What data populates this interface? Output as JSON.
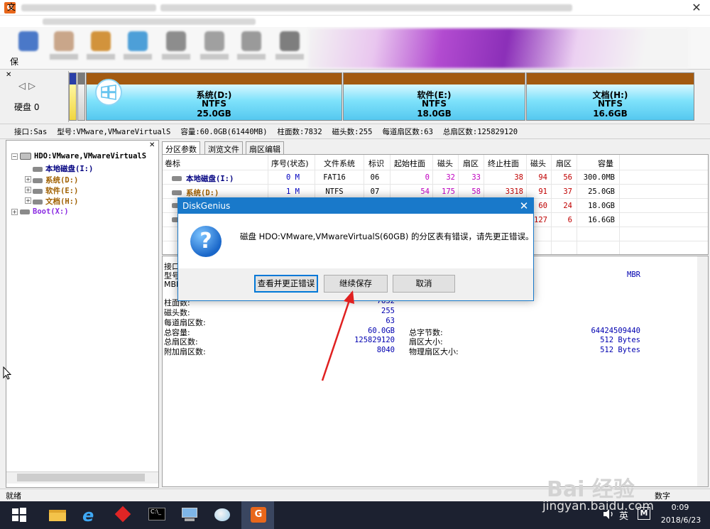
{
  "window": {
    "menu_file": "文",
    "toolbar_save": "保"
  },
  "diskstrip": {
    "disk_label": "硬盘 0",
    "partitions": [
      {
        "name": "系统(D:)",
        "fs": "NTFS",
        "size": "25.0GB"
      },
      {
        "name": "软件(E:)",
        "fs": "NTFS",
        "size": "18.0GB"
      },
      {
        "name": "文档(H:)",
        "fs": "NTFS",
        "size": "16.6GB"
      }
    ]
  },
  "infoline": {
    "interface": "接口:Sas",
    "model": "型号:VMware,VMwareVirtualS",
    "capacity": "容量:60.0GB(61440MB)",
    "cylinders": "柱面数:7832",
    "heads": "磁头数:255",
    "sectors_per_track": "每道扇区数:63",
    "total_sectors": "总扇区数:125829120"
  },
  "tree": {
    "root": "HDO:VMware,VMwareVirtualS",
    "items": [
      {
        "label": "本地磁盘(I:)",
        "color": "#000080"
      },
      {
        "label": "系统(D:)",
        "color": "#a06000"
      },
      {
        "label": "软件(E:)",
        "color": "#a06000"
      },
      {
        "label": "文档(H:)",
        "color": "#a06000"
      },
      {
        "label": "Boot(X:)",
        "color": "#8a2be2"
      }
    ]
  },
  "tabs": [
    "分区参数",
    "浏览文件",
    "扇区编辑"
  ],
  "table": {
    "headers": [
      "卷标",
      "序号(状态)",
      "文件系统",
      "标识",
      "起始柱面",
      "磁头",
      "扇区",
      "终止柱面",
      "磁头",
      "扇区",
      "容量"
    ],
    "rows": [
      {
        "label": "本地磁盘(I:)",
        "label_color": "#000080",
        "seq": "0 M",
        "fs": "FAT16",
        "id": "06",
        "start_cyl": "0",
        "start_head": "32",
        "start_sec": "33",
        "end_cyl": "38",
        "end_head": "94",
        "end_sec": "56",
        "capacity": "300.0MB"
      },
      {
        "label": "系统(D:)",
        "label_color": "#a06000",
        "seq": "1 M",
        "fs": "NTFS",
        "id": "07",
        "start_cyl": "54",
        "start_head": "175",
        "start_sec": "58",
        "end_cyl": "3318",
        "end_head": "91",
        "end_sec": "37",
        "capacity": "25.0GB"
      },
      {
        "label": "",
        "label_color": "#000",
        "seq": "",
        "fs": "",
        "id": "",
        "start_cyl": "",
        "start_head": "",
        "start_sec": "",
        "end_cyl": "",
        "end_head": "60",
        "end_sec": "24",
        "capacity": "18.0GB"
      },
      {
        "label": "",
        "label_color": "#000",
        "seq": "",
        "fs": "",
        "id": "",
        "start_cyl": "",
        "start_head": "",
        "start_sec": "",
        "end_cyl": "",
        "end_head": "127",
        "end_sec": "6",
        "capacity": "16.6GB"
      }
    ]
  },
  "details": {
    "interface_label": "接口",
    "model_label": "型号",
    "mbr_label": "MBR",
    "mbr_value": "MBR",
    "cylinders_label": "柱面数:",
    "cylinders_value": "7832",
    "heads_label": "磁头数:",
    "heads_value": "255",
    "spt_label": "每道扇区数:",
    "spt_value": "63",
    "capacity_label": "总容量:",
    "capacity_value": "60.0GB",
    "total_bytes_label": "总字节数:",
    "total_bytes_value": "64424509440",
    "total_sectors_label": "总扇区数:",
    "total_sectors_value": "125829120",
    "sector_size_label": "扇区大小:",
    "sector_size_value": "512 Bytes",
    "extra_sectors_label": "附加扇区数:",
    "extra_sectors_value": "8040",
    "phys_sector_label": "物理扇区大小:",
    "phys_sector_value": "512 Bytes"
  },
  "dialog": {
    "title": "DiskGenius",
    "message": "磁盘 HDO:VMware,VMwareVirtualS(60GB) 的分区表有错误，请先更正错误。",
    "btn_check": "查看并更正错误",
    "btn_continue": "继续保存",
    "btn_cancel": "取消"
  },
  "statusbar": {
    "status": "就绪",
    "numlock": "数字"
  },
  "taskbar": {
    "time": "0:09",
    "date": "2018/6/23",
    "ime": "英",
    "ime_mode": "M"
  },
  "watermark": {
    "logo": "Bai 经验",
    "site": "jingyan.baidu.com"
  },
  "colors": {
    "arrow": "#e02020",
    "dialog_title": "#1979ca"
  }
}
